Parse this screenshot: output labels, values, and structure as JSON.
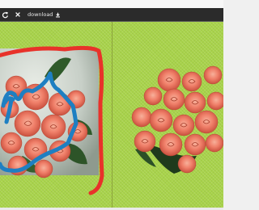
{
  "toolbar": {
    "download_label": "download",
    "icons": [
      "undo-icon",
      "close-icon",
      "download-icon"
    ]
  },
  "colors": {
    "toolbar_bg": "#2b2b2b",
    "canvas_bg": "#a8d34a",
    "foreground_stroke": "#1e7fc2",
    "background_stroke": "#e8322a",
    "rose": "#f0806a"
  }
}
